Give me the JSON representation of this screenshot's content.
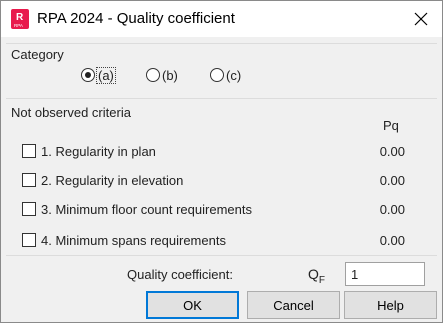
{
  "window": {
    "title": "RPA 2024 - Quality coefficient",
    "icon": "rpa-app-icon",
    "icon_text": "RPA",
    "accent_color": "#e8194c"
  },
  "category": {
    "label": "Category",
    "options": [
      {
        "label": "(a)",
        "selected": true
      },
      {
        "label": "(b)",
        "selected": false
      },
      {
        "label": "(c)",
        "selected": false
      }
    ]
  },
  "criteria": {
    "label": "Not observed criteria",
    "value_header": "Pq",
    "items": [
      {
        "label": "1. Regularity in plan",
        "checked": false,
        "value": "0.00"
      },
      {
        "label": "2. Regularity in elevation",
        "checked": false,
        "value": "0.00"
      },
      {
        "label": "3. Minimum floor count requirements",
        "checked": false,
        "value": "0.00"
      },
      {
        "label": "4. Minimum spans requirements",
        "checked": false,
        "value": "0.00"
      }
    ]
  },
  "quality": {
    "label": "Quality coefficient:",
    "symbol": "Q",
    "symbol_sub": "F",
    "value": "1"
  },
  "buttons": {
    "ok": "OK",
    "cancel": "Cancel",
    "help": "Help"
  }
}
